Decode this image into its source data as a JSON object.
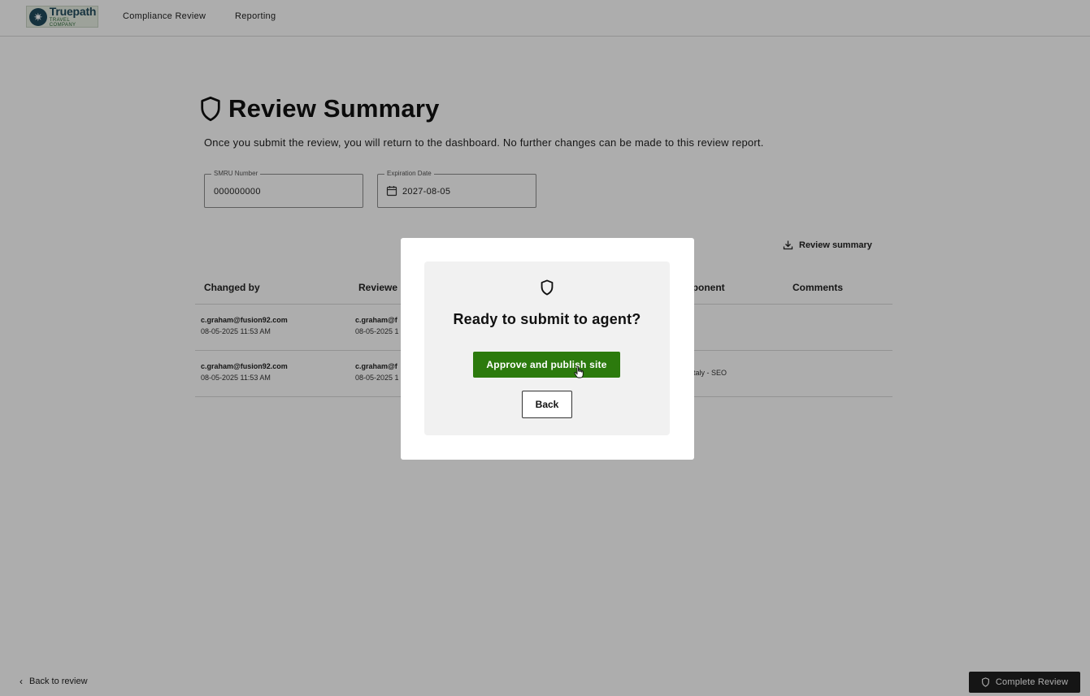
{
  "header": {
    "logo": {
      "name": "Truepath",
      "sub": "TRAVEL COMPANY"
    },
    "nav": [
      {
        "label": "Compliance Review"
      },
      {
        "label": "Reporting"
      }
    ]
  },
  "page": {
    "title": "Review Summary",
    "description": "Once you submit the review, you will return to the dashboard. No further changes can be made to this review report."
  },
  "fields": {
    "smru": {
      "label": "SMRU Number",
      "value": "000000000"
    },
    "expiration": {
      "label": "Expiration Date",
      "value": "2027-08-05"
    }
  },
  "actions": {
    "review_summary_label": "Review summary"
  },
  "table": {
    "headers": [
      "Changed by",
      "Reviewe",
      "mponent",
      "Comments"
    ],
    "rows": [
      {
        "changed_by": "c.graham@fusion92.com",
        "changed_date": "08-05-2025 11:53 AM",
        "reviewer": "c.graham@f",
        "reviewer_date": "08-05-2025 1",
        "component": "",
        "comments": ""
      },
      {
        "changed_by": "c.graham@fusion92.com",
        "changed_date": "08-05-2025 11:53 AM",
        "reviewer": "c.graham@f",
        "reviewer_date": "08-05-2025 1",
        "component": "l Italy - SEO",
        "comments": ""
      }
    ]
  },
  "footer": {
    "back_label": "Back to review",
    "complete_label": "Complete Review"
  },
  "modal": {
    "title": "Ready to submit to agent?",
    "approve_label": "Approve and publish site",
    "back_label": "Back"
  },
  "icons": {
    "title": "shield-icon",
    "modal": "shield-icon",
    "download": "download-icon",
    "calendar": "calendar-icon"
  },
  "colors": {
    "approve": "#2c7a0d",
    "complete": "#1f1f1f"
  }
}
